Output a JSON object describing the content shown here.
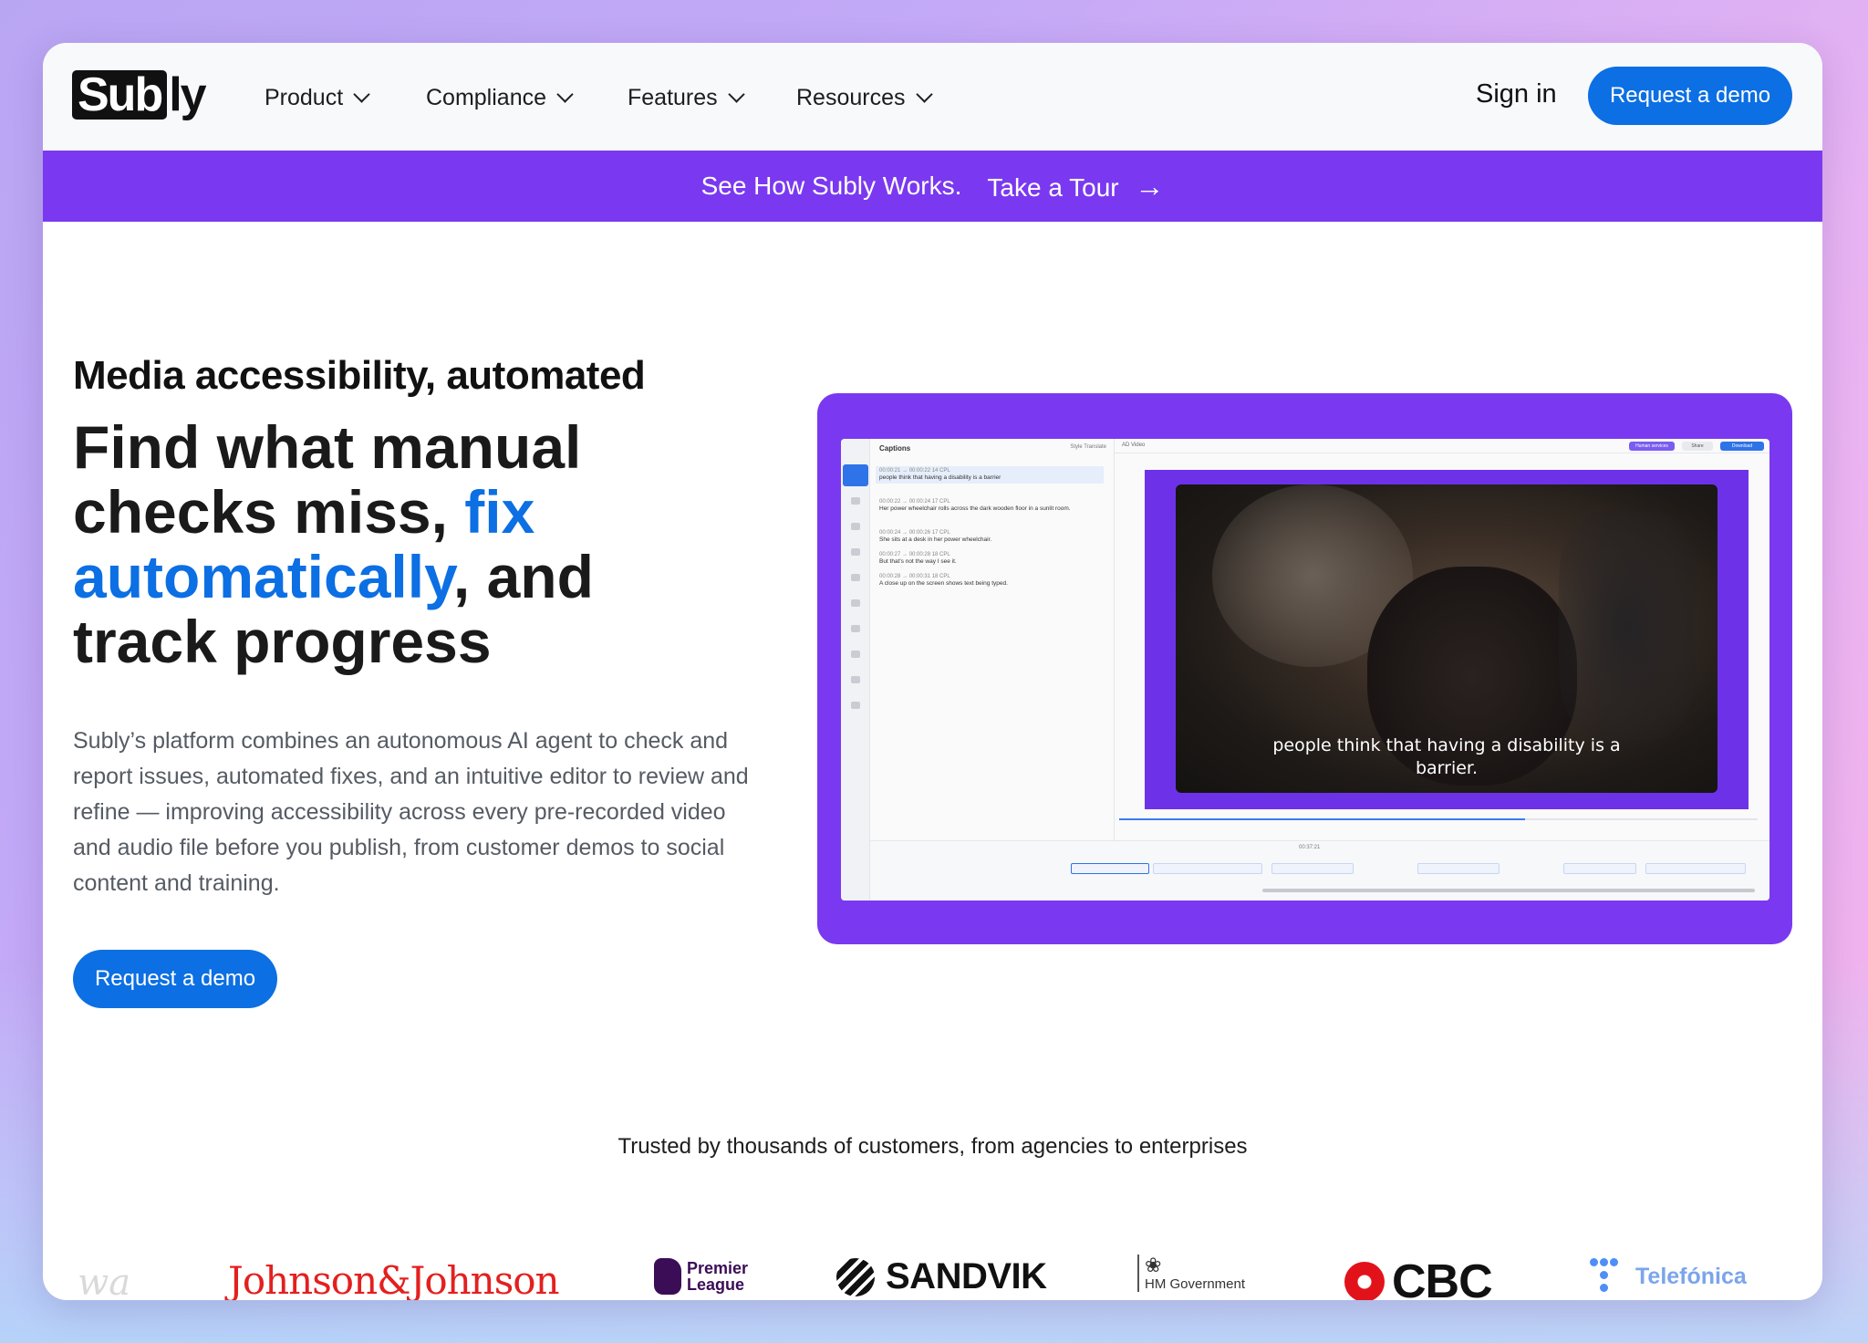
{
  "nav": {
    "logo_box": "Sub",
    "logo_rest": "ly",
    "items": [
      {
        "label": "Product"
      },
      {
        "label": "Compliance"
      },
      {
        "label": "Features"
      },
      {
        "label": "Resources"
      }
    ],
    "sign_in": "Sign in",
    "cta": "Request a demo"
  },
  "banner": {
    "text": "See How Subly Works.",
    "link": "Take a Tour",
    "arrow": "→"
  },
  "hero": {
    "eyebrow": "Media accessibility, automated",
    "headline_1": "Find what manual checks miss, ",
    "headline_accent": "fix automatically",
    "headline_2": ", and track progress",
    "description": "Subly’s platform combines an autonomous AI agent to check and report issues, automated fixes, and an intuitive editor to review and refine — improving accessibility across every pre-recorded video and audio file before you publish, from customer demos to social content and training.",
    "cta": "Request a demo"
  },
  "editor": {
    "panel_title": "Captions",
    "tools": "Style   Translate",
    "video_label": "AD Video",
    "pills": [
      "Human services",
      "Share",
      "Download"
    ],
    "captions": [
      {
        "time": "00:00:21 → 00:00:22  14 CPL",
        "text": "people think that having a disability is a barrier"
      },
      {
        "time": "00:00:22 → 00:00:24  17 CPL",
        "text": "Her power wheelchair rolls across the dark wooden floor in a sunlit room."
      },
      {
        "time": "00:00:24 → 00:00:26  17 CPL",
        "text": "She sits at a desk in her power wheelchair."
      },
      {
        "time": "00:00:27 → 00:00:28  18 CPL",
        "text": "But that's not the way I see it."
      },
      {
        "time": "00:00:28 → 00:00:31  18 CPL",
        "text": "A close up on the screen shows text being typed."
      }
    ],
    "subtitle_line_1": "people think that having a disability is a",
    "subtitle_line_2": "barrier.",
    "timeline_time": "00:37:21"
  },
  "trusted": {
    "text": "Trusted by thousands of customers, from agencies to enterprises",
    "brands": {
      "wa": "wa",
      "jj": "Johnson&Johnson",
      "pl_1": "Premier",
      "pl_2": "League",
      "sandvik": "SANDVIK",
      "hm": "HM Government",
      "cbc": "CBC",
      "telefonica": "Telefónica"
    }
  },
  "colors": {
    "accent_blue": "#0c6fe3",
    "banner_purple": "#7a39f0",
    "jj_red": "#e3201f",
    "premier_purple": "#3b0d57"
  }
}
